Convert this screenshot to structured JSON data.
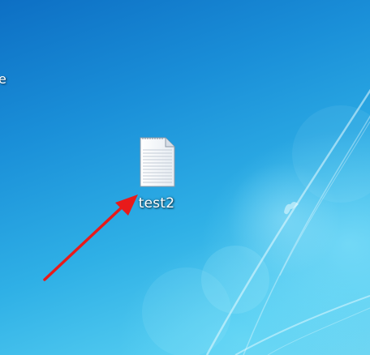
{
  "desktop": {
    "edge_text": "e",
    "icons": [
      {
        "label": "test2",
        "icon": "text-document-icon"
      }
    ]
  },
  "annotation": {
    "type": "arrow",
    "color": "#e81a1a"
  }
}
